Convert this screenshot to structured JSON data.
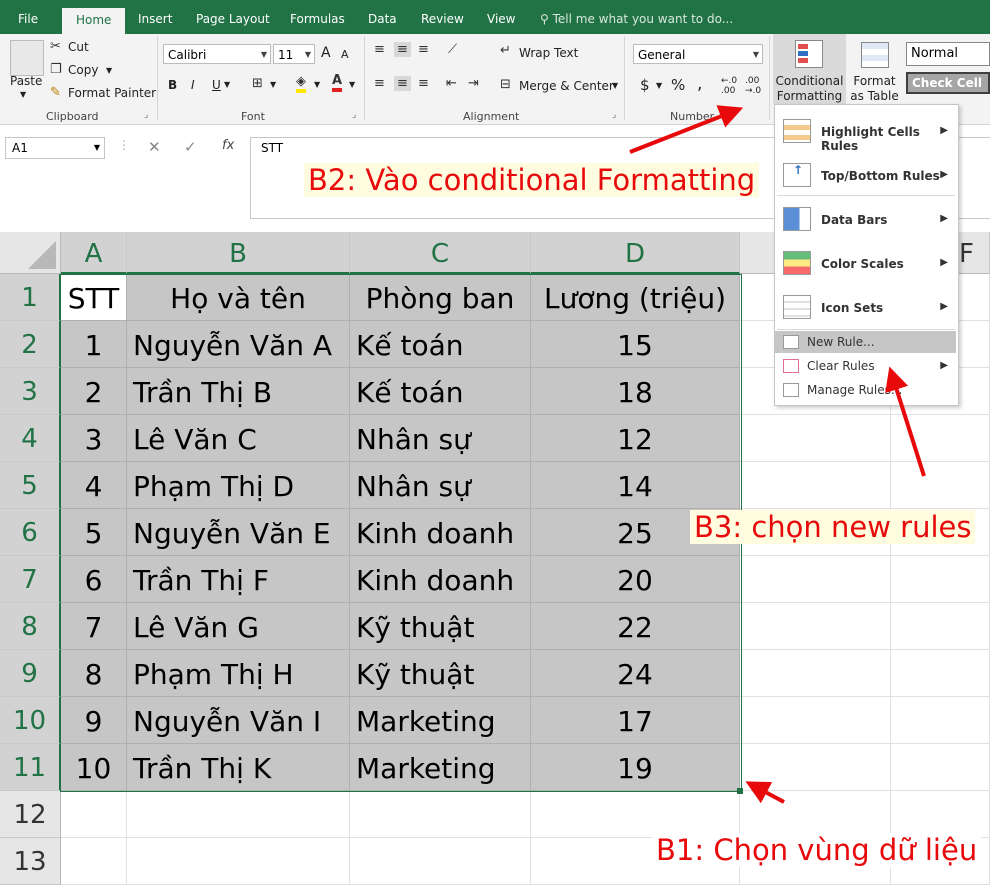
{
  "ribbon": {
    "tabs": [
      "File",
      "Home",
      "Insert",
      "Page Layout",
      "Formulas",
      "Data",
      "Review",
      "View"
    ],
    "active_tab": "Home",
    "tell_me": "Tell me what you want to do...",
    "clipboard": {
      "paste": "Paste",
      "cut": "Cut",
      "copy": "Copy",
      "format_painter": "Format Painter",
      "label": "Clipboard"
    },
    "font": {
      "name": "Calibri",
      "size": "11",
      "label": "Font",
      "bold": "B",
      "italic": "I",
      "underline": "U",
      "grow": "A",
      "shrink": "A"
    },
    "alignment": {
      "wrap_text": "Wrap Text",
      "merge_center": "Merge & Center",
      "label": "Alignment"
    },
    "number": {
      "format": "General",
      "currency": "$",
      "percent": "%",
      "comma": ",",
      "label": "Number"
    },
    "styles": {
      "conditional_formatting": "Conditional Formatting",
      "format_as_table": "Format as Table",
      "normal": "Normal",
      "check_cell": "Check Cell"
    }
  },
  "formula_bar": {
    "name_box": "A1",
    "fx": "fx",
    "content": "STT"
  },
  "sheet": {
    "columns": [
      "A",
      "B",
      "C",
      "D",
      "F"
    ],
    "rows": [
      "1",
      "2",
      "3",
      "4",
      "5",
      "6",
      "7",
      "8",
      "9",
      "10",
      "11",
      "12",
      "13"
    ],
    "header": [
      "STT",
      "Họ và tên",
      "Phòng ban",
      "Lương (triệu)"
    ],
    "data": [
      [
        "1",
        "Nguyễn Văn A",
        "Kế toán",
        "15"
      ],
      [
        "2",
        "Trần Thị B",
        "Kế toán",
        "18"
      ],
      [
        "3",
        "Lê Văn C",
        "Nhân sự",
        "12"
      ],
      [
        "4",
        "Phạm Thị D",
        "Nhân sự",
        "14"
      ],
      [
        "5",
        "Nguyễn Văn E",
        "Kinh doanh",
        "25"
      ],
      [
        "6",
        "Trần Thị F",
        "Kinh doanh",
        "20"
      ],
      [
        "7",
        "Lê Văn G",
        "Kỹ thuật",
        "22"
      ],
      [
        "8",
        "Phạm Thị H",
        "Kỹ thuật",
        "24"
      ],
      [
        "9",
        "Nguyễn Văn I",
        "Marketing",
        "17"
      ],
      [
        "10",
        "Trần Thị K",
        "Marketing",
        "19"
      ]
    ]
  },
  "cf_menu": {
    "items": [
      "Highlight Cells Rules",
      "Top/Bottom Rules",
      "Data Bars",
      "Color Scales",
      "Icon Sets"
    ],
    "new_rule": "New Rule...",
    "clear_rules": "Clear Rules",
    "manage_rules": "Manage Rules..."
  },
  "annotations": {
    "b1": "B1: Chọn vùng dữ liệu",
    "b2": "B2: Vào conditional Formatting",
    "b3": "B3: chọn new rules"
  },
  "colors": {
    "excel_green": "#217346",
    "annotation_red": "#e8090b",
    "selection_gray": "#c6c6c6"
  }
}
